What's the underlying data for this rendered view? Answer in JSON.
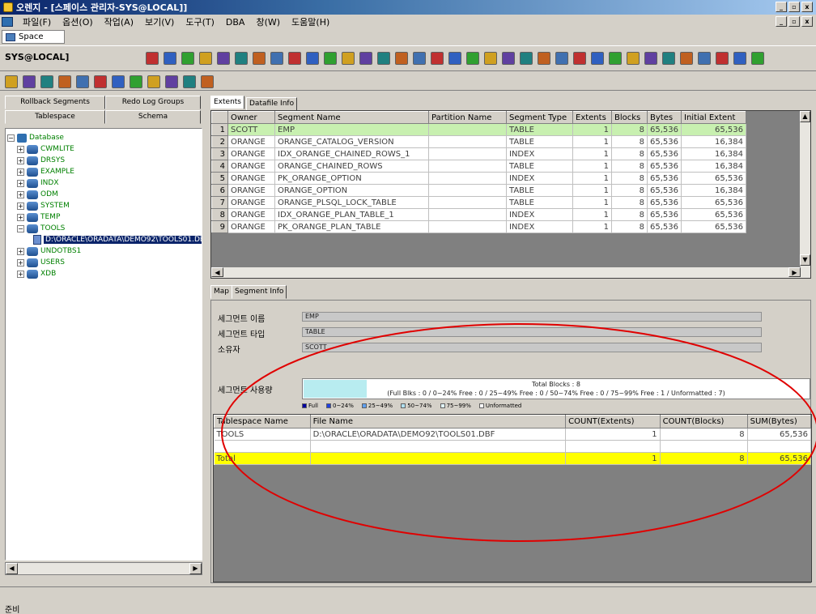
{
  "window": {
    "title": "오렌지 - [스페이스 관리자-SYS@LOCAL]]",
    "minimize": "_",
    "restore": "▫",
    "close": "x"
  },
  "menu": [
    "파일(F)",
    "옵션(O)",
    "작업(A)",
    "보기(V)",
    "도구(T)",
    "DBA",
    "창(W)",
    "도움말(H)"
  ],
  "space_tab": "Space",
  "connection": "SYS@LOCAL]",
  "left_tabs": {
    "rollback": "Rollback Segments",
    "redo": "Redo Log Groups",
    "tablespace": "Tablespace",
    "schema": "Schema"
  },
  "tree": {
    "root": "Database",
    "items": [
      "CWMLITE",
      "DRSYS",
      "EXAMPLE",
      "INDX",
      "ODM",
      "SYSTEM",
      "TEMP",
      "TOOLS"
    ],
    "file": "D:\\ORACLE\\ORADATA\\DEMO92\\TOOLS01.DBF",
    "after": [
      "UNDOTBS1",
      "USERS",
      "XDB"
    ]
  },
  "top_tabs": [
    "Extents",
    "Datafile Info"
  ],
  "extents_grid": {
    "columns": [
      "",
      "Owner",
      "Segment Name",
      "Partition Name",
      "Segment Type",
      "Extents",
      "Blocks",
      "Bytes",
      "Initial Extent"
    ],
    "rows": [
      {
        "no": "1",
        "owner": "SCOTT",
        "segment": "EMP",
        "partition": "",
        "type": "TABLE",
        "extents": "1",
        "blocks": "8",
        "bytes": "65,536",
        "initial": "65,536"
      },
      {
        "no": "2",
        "owner": "ORANGE",
        "segment": "ORANGE_CATALOG_VERSION",
        "partition": "",
        "type": "TABLE",
        "extents": "1",
        "blocks": "8",
        "bytes": "65,536",
        "initial": "16,384"
      },
      {
        "no": "3",
        "owner": "ORANGE",
        "segment": "IDX_ORANGE_CHAINED_ROWS_1",
        "partition": "",
        "type": "INDEX",
        "extents": "1",
        "blocks": "8",
        "bytes": "65,536",
        "initial": "16,384"
      },
      {
        "no": "4",
        "owner": "ORANGE",
        "segment": "ORANGE_CHAINED_ROWS",
        "partition": "",
        "type": "TABLE",
        "extents": "1",
        "blocks": "8",
        "bytes": "65,536",
        "initial": "16,384"
      },
      {
        "no": "5",
        "owner": "ORANGE",
        "segment": "PK_ORANGE_OPTION",
        "partition": "",
        "type": "INDEX",
        "extents": "1",
        "blocks": "8",
        "bytes": "65,536",
        "initial": "65,536"
      },
      {
        "no": "6",
        "owner": "ORANGE",
        "segment": "ORANGE_OPTION",
        "partition": "",
        "type": "TABLE",
        "extents": "1",
        "blocks": "8",
        "bytes": "65,536",
        "initial": "16,384"
      },
      {
        "no": "7",
        "owner": "ORANGE",
        "segment": "ORANGE_PLSQL_LOCK_TABLE",
        "partition": "",
        "type": "TABLE",
        "extents": "1",
        "blocks": "8",
        "bytes": "65,536",
        "initial": "65,536"
      },
      {
        "no": "8",
        "owner": "ORANGE",
        "segment": "IDX_ORANGE_PLAN_TABLE_1",
        "partition": "",
        "type": "INDEX",
        "extents": "1",
        "blocks": "8",
        "bytes": "65,536",
        "initial": "65,536"
      },
      {
        "no": "9",
        "owner": "ORANGE",
        "segment": "PK_ORANGE_PLAN_TABLE",
        "partition": "",
        "type": "INDEX",
        "extents": "1",
        "blocks": "8",
        "bytes": "65,536",
        "initial": "65,536"
      }
    ]
  },
  "bottom_tabs": [
    "Map",
    "Segment Info"
  ],
  "segment_info": {
    "name_label": "세그먼트 이름",
    "name_value": "EMP",
    "type_label": "세그먼트 타입",
    "type_value": "TABLE",
    "owner_label": "소유자",
    "owner_value": "SCOTT",
    "usage_label": "세그먼트 사용량",
    "total_blocks": "Total Blocks : 8",
    "usage_detail": "(Full Blks : 0 / 0~24% Free : 0 / 25~49% Free : 0 / 50~74% Free : 0 / 75~99% Free : 1 / Unformatted : 7)",
    "usage_fraction": 0.125,
    "legend": [
      {
        "label": "Full",
        "color": "#0000a0"
      },
      {
        "label": "0~24%",
        "color": "#2040e0"
      },
      {
        "label": "25~49%",
        "color": "#60a0f0"
      },
      {
        "label": "50~74%",
        "color": "#b0e0f0"
      },
      {
        "label": "75~99%",
        "color": "#e0f4f8"
      },
      {
        "label": "Unformatted",
        "color": "#ffffff"
      }
    ]
  },
  "summary": {
    "columns": [
      "Tablespace Name",
      "File Name",
      "COUNT(Extents)",
      "COUNT(Blocks)",
      "SUM(Bytes)"
    ],
    "row": {
      "ts": "TOOLS",
      "file": "D:\\ORACLE\\ORADATA\\DEMO92\\TOOLS01.DBF",
      "extents": "1",
      "blocks": "8",
      "bytes": "65,536"
    },
    "total": {
      "label": "Total",
      "extents": "1",
      "blocks": "8",
      "bytes": "65,536"
    }
  },
  "status": "준비",
  "colors": {
    "annotation": "#e00000",
    "total_row": "#ffff00",
    "selected_row": "#c8f0b0"
  }
}
